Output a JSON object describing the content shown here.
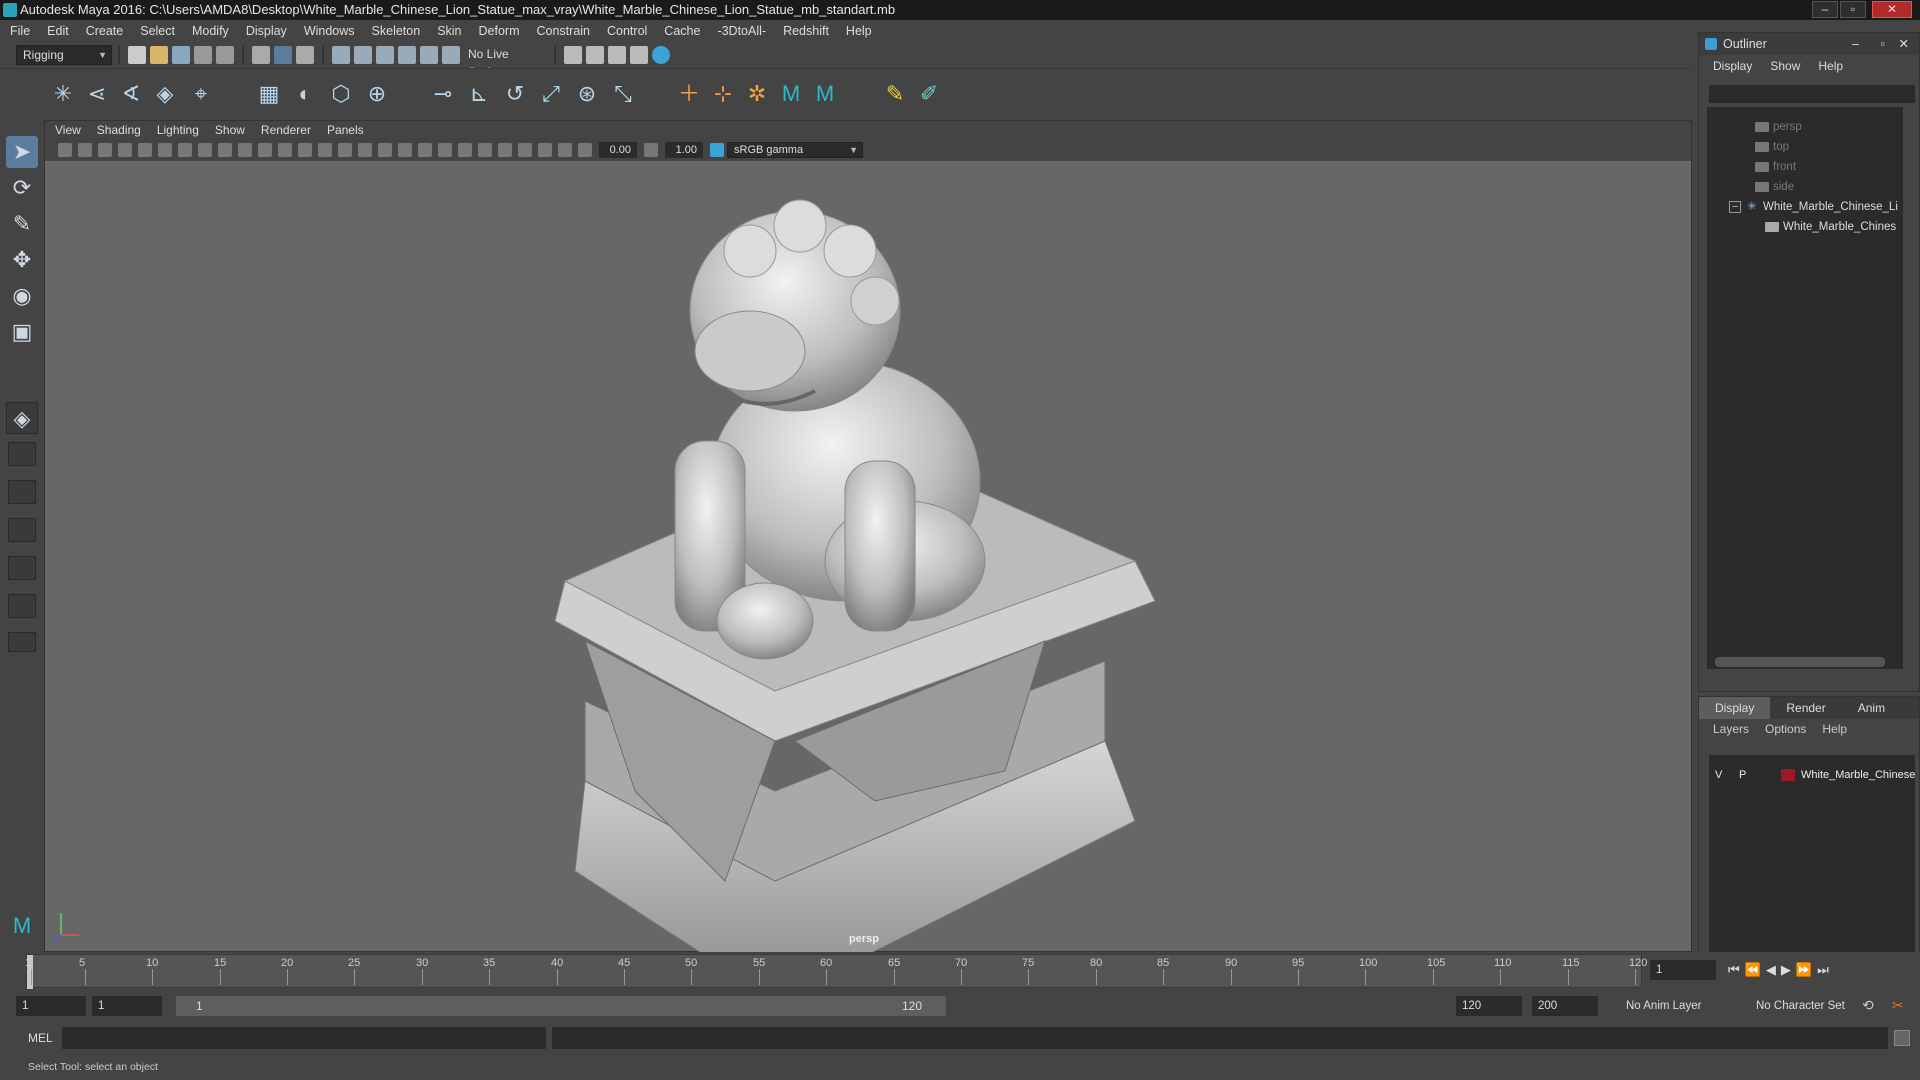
{
  "window": {
    "title": "Autodesk Maya 2016: C:\\Users\\AMDA8\\Desktop\\White_Marble_Chinese_Lion_Statue_max_vray\\White_Marble_Chinese_Lion_Statue_mb_standart.mb"
  },
  "menubar": [
    "File",
    "Edit",
    "Create",
    "Select",
    "Modify",
    "Display",
    "Windows",
    "Skeleton",
    "Skin",
    "Deform",
    "Constrain",
    "Control",
    "Cache",
    "-3DtoAll-",
    "Redshift",
    "Help"
  ],
  "statusline": {
    "mode": "Rigging",
    "live_surface": "No Live Surface"
  },
  "viewport": {
    "menu": [
      "View",
      "Shading",
      "Lighting",
      "Show",
      "Renderer",
      "Panels"
    ],
    "exposure": "0.00",
    "gamma": "1.00",
    "color_space": "sRGB gamma",
    "camera_label": "persp"
  },
  "outliner": {
    "title": "Outliner",
    "menu": [
      "Display",
      "Show",
      "Help"
    ],
    "items": [
      "persp",
      "top",
      "front",
      "side",
      "White_Marble_Chinese_Li",
      "White_Marble_Chines"
    ]
  },
  "layers": {
    "tabs": [
      "Display",
      "Render",
      "Anim"
    ],
    "menu": [
      "Layers",
      "Options",
      "Help"
    ],
    "layer": {
      "v": "V",
      "p": "P",
      "name": "White_Marble_Chinese",
      "color": "#9b1a2a"
    }
  },
  "timeline": {
    "ticks": [
      "1",
      "5",
      "10",
      "15",
      "20",
      "25",
      "30",
      "35",
      "40",
      "45",
      "50",
      "55",
      "60",
      "65",
      "70",
      "75",
      "80",
      "85",
      "90",
      "95",
      "100",
      "105",
      "110",
      "115",
      "120"
    ],
    "current_frame": "1"
  },
  "range": {
    "start": "1",
    "start2": "1",
    "slider_start": "1",
    "slider_end": "120",
    "end": "120",
    "end2": "200",
    "anim_layer": "No Anim Layer",
    "character_set": "No Character Set"
  },
  "command": {
    "label": "MEL"
  },
  "help": {
    "text": "Select Tool: select an object"
  }
}
